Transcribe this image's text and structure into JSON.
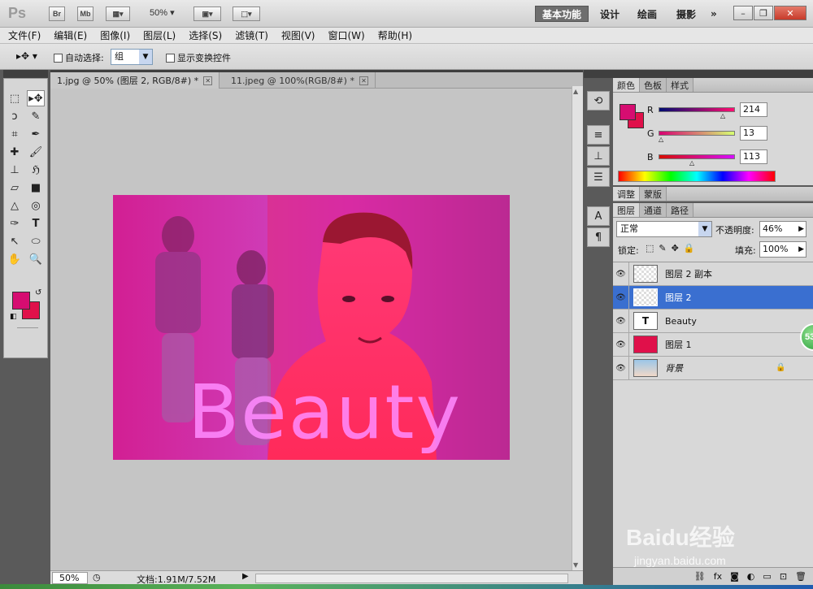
{
  "app": {
    "logo": "Ps",
    "bridge_btn": "Br",
    "minibridge_btn": "Mb",
    "zoom_dropdown": "50%",
    "workspaces": [
      "基本功能",
      "设计",
      "绘画",
      "摄影"
    ],
    "more": "»"
  },
  "menu": [
    "文件(F)",
    "编辑(E)",
    "图像(I)",
    "图层(L)",
    "选择(S)",
    "滤镜(T)",
    "视图(V)",
    "窗口(W)",
    "帮助(H)"
  ],
  "options": {
    "auto_select_label": "自动选择:",
    "auto_select_value": "组",
    "show_transform_label": "显示变换控件"
  },
  "tabs": [
    {
      "label": "1.jpg @ 50% (图层 2, RGB/8#) *",
      "active": true
    },
    {
      "label": "11.jpeg @ 100%(RGB/8#) *",
      "active": false
    }
  ],
  "document": {
    "overlay_text": "Beauty"
  },
  "status": {
    "zoom": "50%",
    "doc_size": "文档:1.91M/7.52M"
  },
  "color_panel": {
    "tabs": [
      "颜色",
      "色板",
      "样式"
    ],
    "r_label": "R",
    "g_label": "G",
    "b_label": "B",
    "r": "214",
    "g": "13",
    "b": "113",
    "foreground": "#d60d71",
    "background": "#e0104a"
  },
  "adjust_panel": {
    "tabs": [
      "调整",
      "蒙版"
    ]
  },
  "layers_panel": {
    "tabs": [
      "图层",
      "通道",
      "路径"
    ],
    "blend_mode": "正常",
    "opacity_label": "不透明度:",
    "opacity": "46%",
    "lock_label": "锁定:",
    "fill_label": "填充:",
    "fill": "100%",
    "layers": [
      {
        "name": "图层 2 副本",
        "type": "image",
        "selected": false
      },
      {
        "name": "图层 2",
        "type": "image",
        "selected": true
      },
      {
        "name": "Beauty",
        "type": "text",
        "selected": false
      },
      {
        "name": "图层 1",
        "type": "fill",
        "selected": false
      },
      {
        "name": "背景",
        "type": "photo",
        "selected": false,
        "locked": true
      }
    ],
    "text_thumb": "T",
    "footer_icons": [
      "link-icon",
      "fx-icon",
      "mask-icon",
      "adjustment-icon",
      "group-icon",
      "new-layer-icon",
      "trash-icon"
    ]
  },
  "badge": "53",
  "watermark": {
    "brand": "Baidu经验",
    "url": "jingyan.baidu.com"
  }
}
